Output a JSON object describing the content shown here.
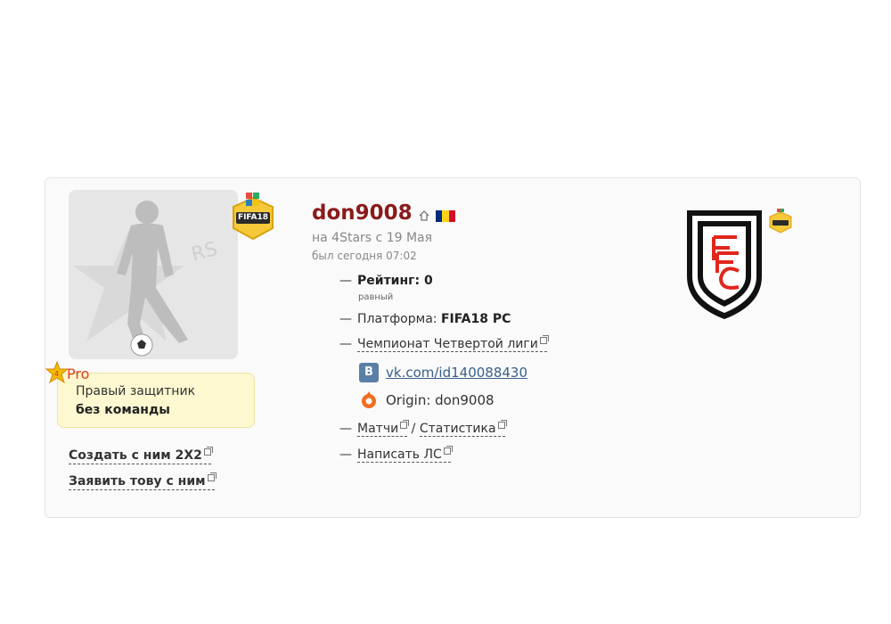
{
  "profile": {
    "username": "don9008",
    "since": "на 4Stars с 19 Мая",
    "last_seen": "был сегодня 07:02",
    "badge_label": "FIFA18",
    "pro_label": "Pro",
    "position": "Правый защитник",
    "team": "без команды"
  },
  "actions": {
    "create_2x2": "Создать с ним 2Х2",
    "apply_team": "Заявить тову с ним"
  },
  "info": {
    "rating_label": "Рейтинг: 0",
    "rating_sub": "равный",
    "platform_prefix": "Платформа: ",
    "platform_value": "FIFA18 PC",
    "league": "Чемпионат Четвертой лиги",
    "vk_link": "vk.com/id140088430",
    "vk_icon_letter": "B",
    "origin": "Origin: don9008",
    "matches": "Матчи",
    "separator": " / ",
    "stats": "Статистика",
    "write_pm": "Написать ЛС"
  },
  "icons": {
    "home": "home-icon",
    "flag": "romania-flag-icon",
    "external": "external-link-icon",
    "vk": "vk-icon",
    "origin": "origin-icon"
  },
  "colors": {
    "username": "#8b1b1b",
    "role_box": "#fdf8d0",
    "vk": "#5b7fa6",
    "origin": "#f26c1f",
    "pro": "#e0421c"
  }
}
